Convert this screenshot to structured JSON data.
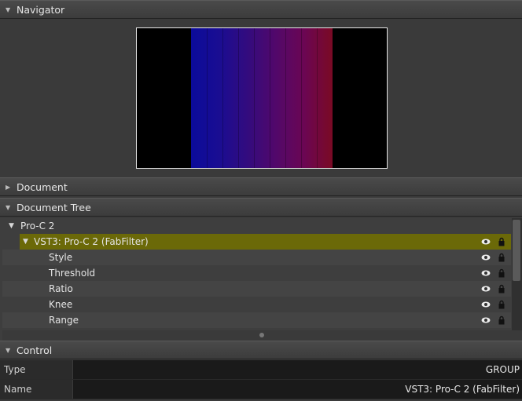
{
  "navigator": {
    "title": "Navigator",
    "expanded": true
  },
  "document": {
    "title": "Document",
    "expanded": false
  },
  "document_tree": {
    "title": "Document Tree",
    "root": {
      "label": "Pro-C 2"
    },
    "items": [
      {
        "label": "VST3: Pro-C 2 (FabFilter)",
        "selected": true
      },
      {
        "label": "Style"
      },
      {
        "label": "Threshold"
      },
      {
        "label": "Ratio"
      },
      {
        "label": "Knee"
      },
      {
        "label": "Range"
      }
    ]
  },
  "control": {
    "title": "Control",
    "rows": [
      {
        "key": "Type",
        "value": "GROUP"
      },
      {
        "key": "Name",
        "value": "VST3: Pro-C 2 (FabFilter)"
      }
    ]
  },
  "colors": {
    "selection": "#6b6908",
    "panel": "#3b3b3b"
  }
}
